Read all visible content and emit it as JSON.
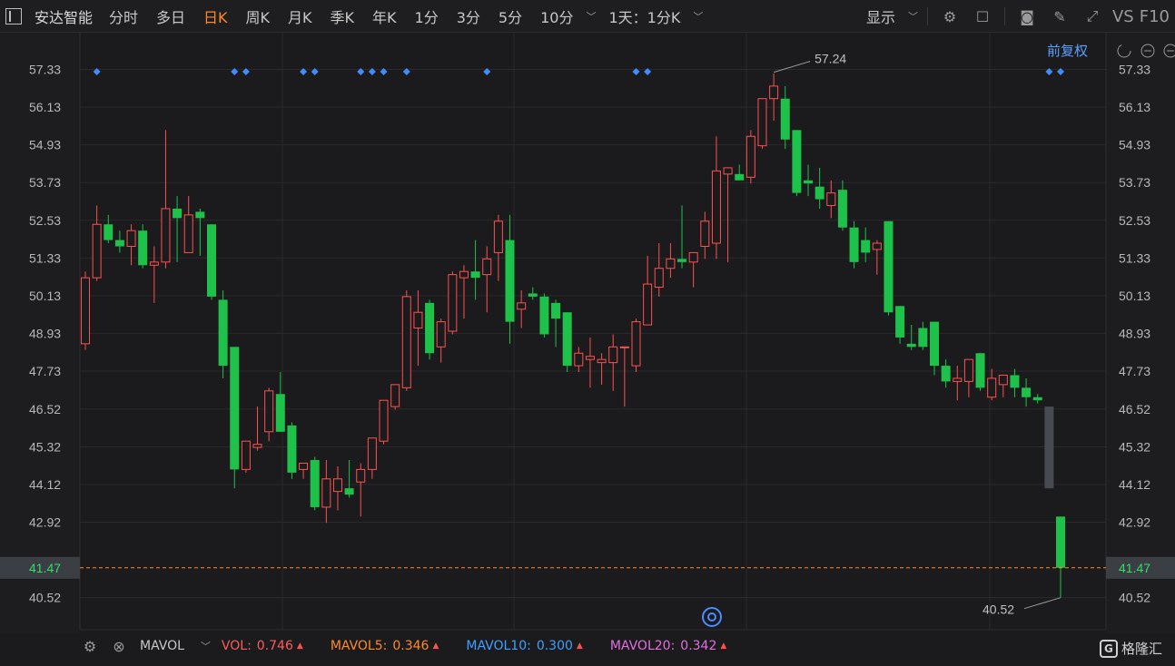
{
  "toolbar": {
    "stock_name": "安达智能",
    "periods": [
      "分时",
      "多日",
      "日K",
      "周K",
      "月K",
      "季K",
      "年K",
      "1分",
      "3分",
      "5分",
      "10分"
    ],
    "active_period": "日K",
    "intraday_option": "1天：1分K",
    "display_label": "显示",
    "vs_label": "VS",
    "f10_label": "F10"
  },
  "chart_header": {
    "adjust_label": "前复权"
  },
  "sub_indicator": {
    "name": "MAVOL",
    "items": [
      {
        "label": "VOL:",
        "value": "0.746",
        "color": "#ff5a5a"
      },
      {
        "label": "MAVOL5:",
        "value": "0.346",
        "color": "#ff8a2a"
      },
      {
        "label": "MAVOL10:",
        "value": "0.300",
        "color": "#3fa0ff"
      },
      {
        "label": "MAVOL20:",
        "value": "0.342",
        "color": "#e070e0"
      }
    ]
  },
  "logo_text": "格隆汇",
  "colors": {
    "up": "#ff5050",
    "down": "#1ec24a",
    "accent": "#ff8a2a",
    "marker": "#3f8cff"
  },
  "chart_data": {
    "type": "candlestick",
    "y_ticks": [
      "57.33",
      "56.13",
      "54.93",
      "53.73",
      "52.53",
      "51.33",
      "50.13",
      "48.93",
      "47.73",
      "46.52",
      "45.32",
      "44.12",
      "42.92",
      "40.52"
    ],
    "ylim": [
      39.5,
      58.5
    ],
    "current_price": "41.47",
    "annotations": {
      "high": "57.24",
      "low": "40.52"
    },
    "candles": [
      {
        "o": 48.6,
        "h": 50.9,
        "l": 48.4,
        "c": 50.7
      },
      {
        "o": 50.7,
        "h": 53.0,
        "l": 50.6,
        "c": 52.4
      },
      {
        "o": 52.4,
        "h": 52.7,
        "l": 51.8,
        "c": 51.9
      },
      {
        "o": 51.9,
        "h": 52.2,
        "l": 51.5,
        "c": 51.7
      },
      {
        "o": 51.7,
        "h": 52.4,
        "l": 51.1,
        "c": 52.2
      },
      {
        "o": 52.2,
        "h": 52.4,
        "l": 51.0,
        "c": 51.1
      },
      {
        "o": 51.1,
        "h": 51.7,
        "l": 49.9,
        "c": 51.2
      },
      {
        "o": 51.2,
        "h": 55.4,
        "l": 51.0,
        "c": 52.9
      },
      {
        "o": 52.9,
        "h": 53.3,
        "l": 51.2,
        "c": 52.6
      },
      {
        "o": 51.5,
        "h": 53.3,
        "l": 51.5,
        "c": 52.7
      },
      {
        "o": 52.8,
        "h": 52.9,
        "l": 51.4,
        "c": 52.6
      },
      {
        "o": 52.4,
        "h": 52.4,
        "l": 50.0,
        "c": 50.1
      },
      {
        "o": 50.0,
        "h": 50.3,
        "l": 47.5,
        "c": 47.9
      },
      {
        "o": 48.5,
        "h": 48.5,
        "l": 44.0,
        "c": 44.6
      },
      {
        "o": 44.6,
        "h": 45.5,
        "l": 44.5,
        "c": 45.5
      },
      {
        "o": 45.3,
        "h": 46.6,
        "l": 45.2,
        "c": 45.4
      },
      {
        "o": 45.8,
        "h": 47.2,
        "l": 45.5,
        "c": 47.1
      },
      {
        "o": 47.0,
        "h": 47.7,
        "l": 45.8,
        "c": 45.8
      },
      {
        "o": 46.0,
        "h": 46.1,
        "l": 44.3,
        "c": 44.5
      },
      {
        "o": 44.6,
        "h": 44.8,
        "l": 44.3,
        "c": 44.8
      },
      {
        "o": 44.9,
        "h": 45.0,
        "l": 43.3,
        "c": 43.4
      },
      {
        "o": 43.4,
        "h": 44.9,
        "l": 42.9,
        "c": 44.3
      },
      {
        "o": 43.9,
        "h": 44.7,
        "l": 43.3,
        "c": 44.3
      },
      {
        "o": 44.0,
        "h": 44.9,
        "l": 43.7,
        "c": 43.8
      },
      {
        "o": 44.2,
        "h": 44.8,
        "l": 43.1,
        "c": 44.6
      },
      {
        "o": 44.6,
        "h": 45.6,
        "l": 44.3,
        "c": 45.6
      },
      {
        "o": 45.5,
        "h": 46.6,
        "l": 45.4,
        "c": 46.8
      },
      {
        "o": 46.6,
        "h": 47.2,
        "l": 46.5,
        "c": 47.3
      },
      {
        "o": 47.2,
        "h": 50.3,
        "l": 47.1,
        "c": 50.1
      },
      {
        "o": 49.1,
        "h": 50.3,
        "l": 47.9,
        "c": 49.6
      },
      {
        "o": 49.9,
        "h": 50.0,
        "l": 48.1,
        "c": 48.3
      },
      {
        "o": 48.5,
        "h": 49.4,
        "l": 48.0,
        "c": 49.3
      },
      {
        "o": 49.0,
        "h": 50.9,
        "l": 48.9,
        "c": 50.8
      },
      {
        "o": 50.7,
        "h": 51.1,
        "l": 49.4,
        "c": 50.9
      },
      {
        "o": 50.9,
        "h": 51.9,
        "l": 50.0,
        "c": 50.7
      },
      {
        "o": 50.8,
        "h": 51.7,
        "l": 49.6,
        "c": 51.3
      },
      {
        "o": 51.5,
        "h": 52.7,
        "l": 50.6,
        "c": 52.5
      },
      {
        "o": 51.9,
        "h": 52.7,
        "l": 48.6,
        "c": 49.3
      },
      {
        "o": 49.7,
        "h": 50.3,
        "l": 49.1,
        "c": 49.9
      },
      {
        "o": 50.2,
        "h": 50.4,
        "l": 50.0,
        "c": 50.1
      },
      {
        "o": 50.1,
        "h": 50.2,
        "l": 48.8,
        "c": 48.9
      },
      {
        "o": 49.9,
        "h": 50.0,
        "l": 48.5,
        "c": 49.4
      },
      {
        "o": 49.6,
        "h": 49.6,
        "l": 47.7,
        "c": 47.9
      },
      {
        "o": 47.9,
        "h": 48.5,
        "l": 47.7,
        "c": 48.3
      },
      {
        "o": 48.1,
        "h": 48.8,
        "l": 47.2,
        "c": 48.2
      },
      {
        "o": 48.0,
        "h": 48.3,
        "l": 47.3,
        "c": 48.1
      },
      {
        "o": 48.0,
        "h": 48.9,
        "l": 47.1,
        "c": 48.5
      },
      {
        "o": 48.5,
        "h": 48.5,
        "l": 46.6,
        "c": 48.5
      },
      {
        "o": 47.9,
        "h": 49.4,
        "l": 47.7,
        "c": 49.3
      },
      {
        "o": 49.2,
        "h": 51.4,
        "l": 49.2,
        "c": 50.5
      },
      {
        "o": 50.4,
        "h": 51.8,
        "l": 50.1,
        "c": 51.0
      },
      {
        "o": 51.0,
        "h": 51.8,
        "l": 50.7,
        "c": 51.3
      },
      {
        "o": 51.3,
        "h": 53.0,
        "l": 51.0,
        "c": 51.2
      },
      {
        "o": 51.2,
        "h": 51.5,
        "l": 50.4,
        "c": 51.5
      },
      {
        "o": 51.7,
        "h": 52.8,
        "l": 51.3,
        "c": 52.5
      },
      {
        "o": 51.8,
        "h": 55.2,
        "l": 51.3,
        "c": 54.1
      },
      {
        "o": 54.0,
        "h": 54.2,
        "l": 51.2,
        "c": 54.2
      },
      {
        "o": 54.0,
        "h": 54.3,
        "l": 53.8,
        "c": 53.8
      },
      {
        "o": 53.9,
        "h": 55.4,
        "l": 53.7,
        "c": 55.2
      },
      {
        "o": 54.9,
        "h": 56.3,
        "l": 54.8,
        "c": 56.4
      },
      {
        "o": 56.4,
        "h": 57.2,
        "l": 55.7,
        "c": 56.8
      },
      {
        "o": 56.4,
        "h": 56.8,
        "l": 54.8,
        "c": 55.1
      },
      {
        "o": 55.4,
        "h": 55.4,
        "l": 53.3,
        "c": 53.4
      },
      {
        "o": 53.8,
        "h": 54.3,
        "l": 53.3,
        "c": 53.7
      },
      {
        "o": 53.6,
        "h": 54.2,
        "l": 52.9,
        "c": 53.2
      },
      {
        "o": 53.0,
        "h": 53.8,
        "l": 52.6,
        "c": 53.4
      },
      {
        "o": 53.5,
        "h": 53.8,
        "l": 52.2,
        "c": 52.3
      },
      {
        "o": 52.3,
        "h": 52.5,
        "l": 51.0,
        "c": 51.2
      },
      {
        "o": 51.9,
        "h": 52.3,
        "l": 51.2,
        "c": 51.5
      },
      {
        "o": 51.6,
        "h": 51.9,
        "l": 50.8,
        "c": 51.8
      },
      {
        "o": 52.5,
        "h": 52.5,
        "l": 49.5,
        "c": 49.6
      },
      {
        "o": 49.8,
        "h": 49.8,
        "l": 48.6,
        "c": 48.8
      },
      {
        "o": 48.6,
        "h": 49.2,
        "l": 48.4,
        "c": 48.5
      },
      {
        "o": 49.1,
        "h": 49.3,
        "l": 48.4,
        "c": 48.5
      },
      {
        "o": 49.3,
        "h": 49.3,
        "l": 47.6,
        "c": 47.9
      },
      {
        "o": 47.9,
        "h": 48.1,
        "l": 47.2,
        "c": 47.4
      },
      {
        "o": 47.4,
        "h": 47.9,
        "l": 46.8,
        "c": 47.5
      },
      {
        "o": 47.4,
        "h": 48.0,
        "l": 46.9,
        "c": 48.1
      },
      {
        "o": 48.3,
        "h": 48.3,
        "l": 47.1,
        "c": 47.2
      },
      {
        "o": 46.9,
        "h": 47.8,
        "l": 46.8,
        "c": 47.5
      },
      {
        "o": 47.3,
        "h": 47.5,
        "l": 46.9,
        "c": 47.6
      },
      {
        "o": 47.6,
        "h": 47.8,
        "l": 46.9,
        "c": 47.2
      },
      {
        "o": 47.2,
        "h": 47.5,
        "l": 46.6,
        "c": 46.9
      },
      {
        "o": 46.9,
        "h": 47.0,
        "l": 46.7,
        "c": 46.8
      },
      {
        "o": 46.6,
        "h": 46.6,
        "l": 44.0,
        "c": 44.0
      },
      {
        "o": 43.1,
        "h": 43.1,
        "l": 40.52,
        "c": 41.47
      }
    ],
    "placeholder_candle": {
      "index": 84
    },
    "markers": [
      1,
      13,
      14,
      19,
      20,
      24,
      25,
      26,
      28,
      35,
      48,
      49,
      84,
      85
    ],
    "grid": true
  }
}
